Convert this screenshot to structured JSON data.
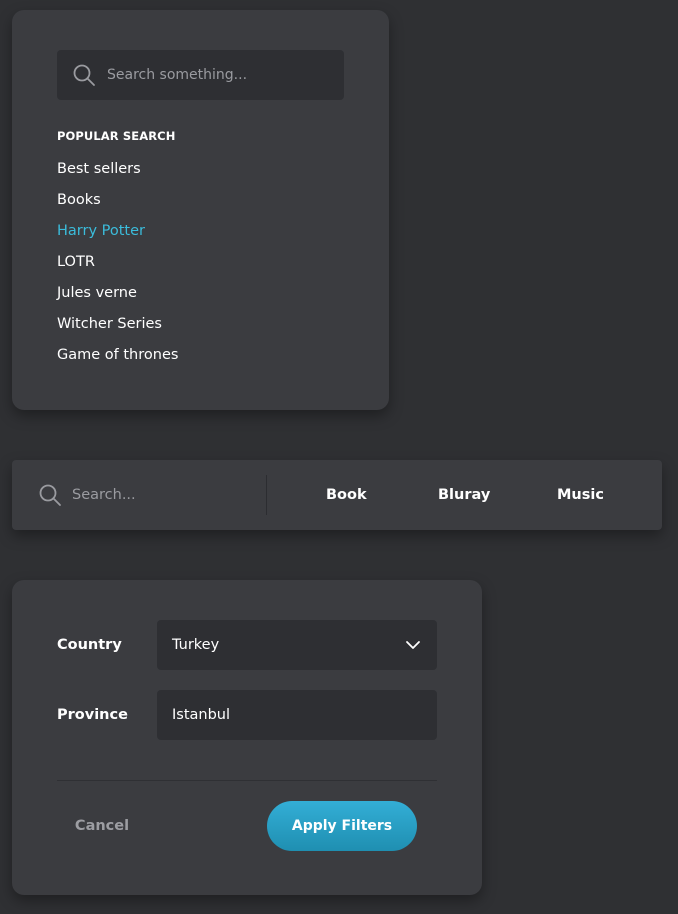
{
  "popular_card": {
    "search_placeholder": "Search something...",
    "heading": "POPULAR SEARCH",
    "items": [
      "Best sellers",
      "Books",
      "Harry Potter",
      "LOTR",
      "Jules verne",
      "Witcher Series",
      "Game of thrones"
    ],
    "active_item": "Harry Potter"
  },
  "search_bar": {
    "placeholder": "Search...",
    "categories": [
      "Book",
      "Bluray",
      "Music"
    ]
  },
  "filters": {
    "country_label": "Country",
    "country_value": "Turkey",
    "province_label": "Province",
    "province_value": "Istanbul",
    "cancel_label": "Cancel",
    "apply_label": "Apply Filters"
  },
  "colors": {
    "background": "#2f3033",
    "card": "#3b3c40",
    "field": "#2e2f33",
    "accent": "#3bbcdb",
    "muted_text": "#9a9ba0"
  }
}
